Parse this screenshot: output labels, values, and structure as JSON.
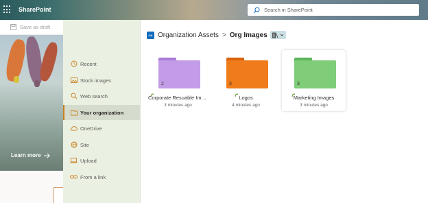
{
  "topbar": {
    "app_name": "SharePoint",
    "search_placeholder": "Search in SharePoint"
  },
  "background_page": {
    "save_draft_label": "Save as draft",
    "learn_more_label": "Learn more"
  },
  "sidebar": {
    "items": [
      {
        "label": "Recent",
        "icon": "clock-icon",
        "active": false
      },
      {
        "label": "Stock images",
        "icon": "image-icon",
        "active": false
      },
      {
        "label": "Web search",
        "icon": "search-icon",
        "active": false
      },
      {
        "label": "Your organization",
        "icon": "folder-icon",
        "active": true
      },
      {
        "label": "OneDrive",
        "icon": "cloud-icon",
        "active": false
      },
      {
        "label": "Site",
        "icon": "globe-icon",
        "active": false
      },
      {
        "label": "Upload",
        "icon": "laptop-icon",
        "active": false
      },
      {
        "label": "From a link",
        "icon": "link-icon",
        "active": false
      }
    ]
  },
  "breadcrumb": {
    "library_icon_text": "OA",
    "parent": "Organization Assets",
    "separator": ">",
    "current": "Org Images"
  },
  "folders": [
    {
      "name": "Corporate Resuable Ima...",
      "count": "2",
      "modified": "3 minutes ago",
      "color": "#c39ce8",
      "tab_color": "#a97cd6",
      "selected": false
    },
    {
      "name": "Logos",
      "count": "3",
      "modified": "4 minutes ago",
      "color": "#f07b1a",
      "tab_color": "#d9620a",
      "selected": false
    },
    {
      "name": "Marketing Images",
      "count": "3",
      "modified": "3 minutes ago",
      "color": "#7fcd78",
      "tab_color": "#5cb55a",
      "selected": true
    }
  ],
  "colors": {
    "accent": "#ca7f1e",
    "panel_bg": "#eaf0e2",
    "brand_blue": "#0f6cbd"
  }
}
